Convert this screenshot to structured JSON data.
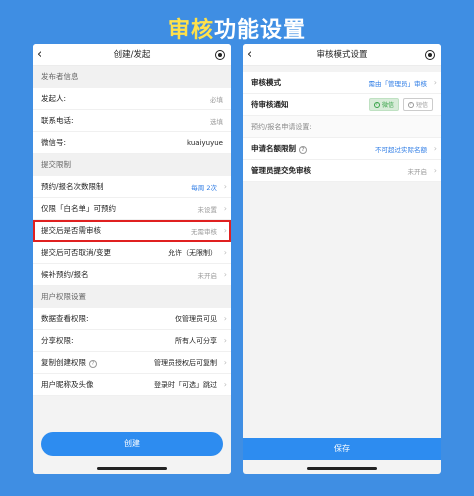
{
  "banner": {
    "highlight": "审核",
    "rest": "功能设置"
  },
  "left": {
    "title": "创建/发起",
    "sections": [
      {
        "header": "发布者信息",
        "rows": [
          {
            "label": "发起人:",
            "value": "必填",
            "style": "muted"
          },
          {
            "label": "联系电话:",
            "value": "选填",
            "style": "muted"
          },
          {
            "label": "微信号:",
            "value": "kuaiyuyue",
            "style": "dark"
          }
        ]
      },
      {
        "header": "提交限制",
        "rows": [
          {
            "label": "预约/报名次数限制",
            "value": "每周 2次",
            "style": "blue",
            "chev": true
          },
          {
            "label": "仅限「白名单」可预约",
            "value": "未设置",
            "style": "muted",
            "chev": true
          },
          {
            "label": "提交后是否需审核",
            "value": "无需审核",
            "style": "muted",
            "chev": true,
            "highlight": true
          },
          {
            "label": "提交后可否取消/变更",
            "value": "允许（无限制）",
            "style": "dark",
            "chev": true
          },
          {
            "label": "候补预约/报名",
            "value": "未开启",
            "style": "muted",
            "chev": true
          }
        ]
      },
      {
        "header": "用户权限设置",
        "rows": [
          {
            "label": "数据查看权限:",
            "value": "仅管理员可见",
            "style": "dark",
            "chev": true
          },
          {
            "label": "分享权限:",
            "value": "所有人可分享",
            "style": "dark",
            "chev": true
          },
          {
            "label": "复制创建权限",
            "value": "管理员授权后可复制",
            "style": "dark",
            "chev": true,
            "help": true
          },
          {
            "label": "用户昵称及头像",
            "value": "登录时「可选」跳过",
            "style": "dark",
            "chev": true
          }
        ]
      }
    ],
    "button": "创建"
  },
  "right": {
    "title": "审核模式设置",
    "mode_label": "审核模式",
    "mode_value": "需由「管理员」审核",
    "notify_label": "待审核通知",
    "chip_wechat": "微信",
    "chip_sms": "短信",
    "subhead": "预约/报名申请设置:",
    "quota_label": "申请名额限制",
    "quota_value": "不可超过实际名额",
    "exempt_label": "管理员提交免审核",
    "exempt_value": "未开启",
    "button": "保存"
  }
}
